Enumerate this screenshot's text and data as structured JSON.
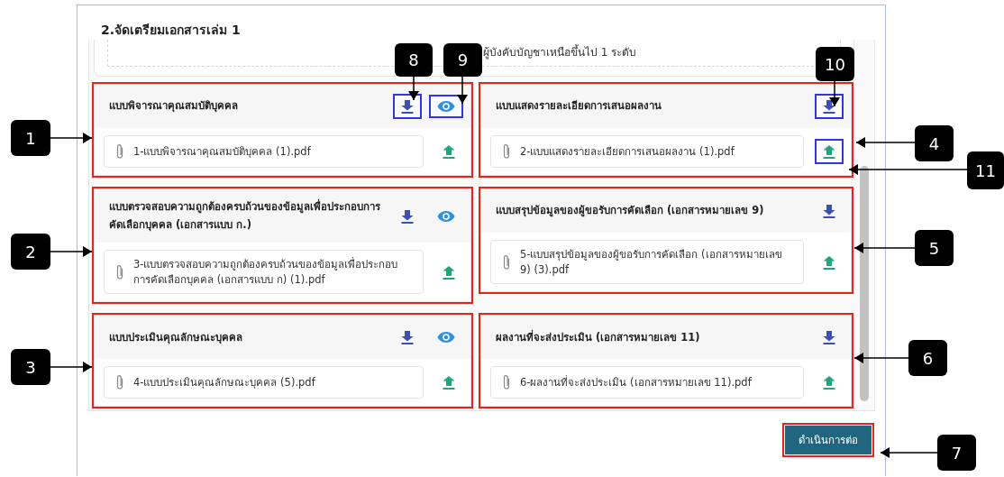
{
  "section_title": "2.จัดเตรียมเอกสารเล่ม 1",
  "note_box": {
    "text": "ผู้บังคับบัญชาเหนือขึ้นไป 1 ระดับ"
  },
  "cards": [
    {
      "title": "แบบพิจารณาคุณสมบัติบุคคล",
      "file": "1-แบบพิจารณาคุณสมบัติบุคคล (1).pdf",
      "highlighted": true,
      "download_highlighted": true,
      "view": {
        "highlighted": true
      },
      "upload_highlighted": false
    },
    {
      "title": "แบบแสดงรายละเอียดการเสนอผลงาน",
      "file": "2-แบบแสดงรายละเอียดการเสนอผลงาน (1).pdf",
      "highlighted": true,
      "download_highlighted": true,
      "upload_highlighted": true
    },
    {
      "title": "แบบตรวจสอบความถูกต้องครบถ้วนของข้อมูลเพื่อประกอบการคัดเลือกบุคคล (เอกสารแบบ ก.)",
      "file": "3-แบบตรวจสอบความถูกต้องครบถ้วนของข้อมูลเพื่อประกอบการคัดเลือกบุคคล (เอกสารแบบ ก) (1).pdf",
      "highlighted": true,
      "download_highlighted": false,
      "view": {
        "highlighted": false
      },
      "upload_highlighted": false
    },
    {
      "title": "แบบสรุปข้อมูลของผู้ขอรับการคัดเลือก (เอกสารหมายเลข 9)",
      "file": "5-แบบสรุปข้อมูลของผู้ขอรับการคัดเลือก (เอกสารหมายเลข 9) (3).pdf",
      "highlighted": true,
      "download_highlighted": false,
      "upload_highlighted": false
    },
    {
      "title": "แบบประเมินคุณลักษณะบุคคล",
      "file": "4-แบบประเมินคุณลักษณะบุคคล (5).pdf",
      "highlighted": true,
      "download_highlighted": false,
      "view": {
        "highlighted": false
      },
      "upload_highlighted": false
    },
    {
      "title": "ผลงานที่จะส่งประเมิน (เอกสารหมายเลข 11)",
      "file": "6-ผลงานที่จะส่งประเมิน (เอกสารหมายเลข 11).pdf",
      "highlighted": true,
      "download_highlighted": false,
      "upload_highlighted": false
    }
  ],
  "submit_button": {
    "label": "ดำเนินการต่อ",
    "highlighted": true
  },
  "callouts": [
    "1",
    "2",
    "3",
    "4",
    "5",
    "6",
    "7",
    "8",
    "9",
    "10",
    "11"
  ]
}
